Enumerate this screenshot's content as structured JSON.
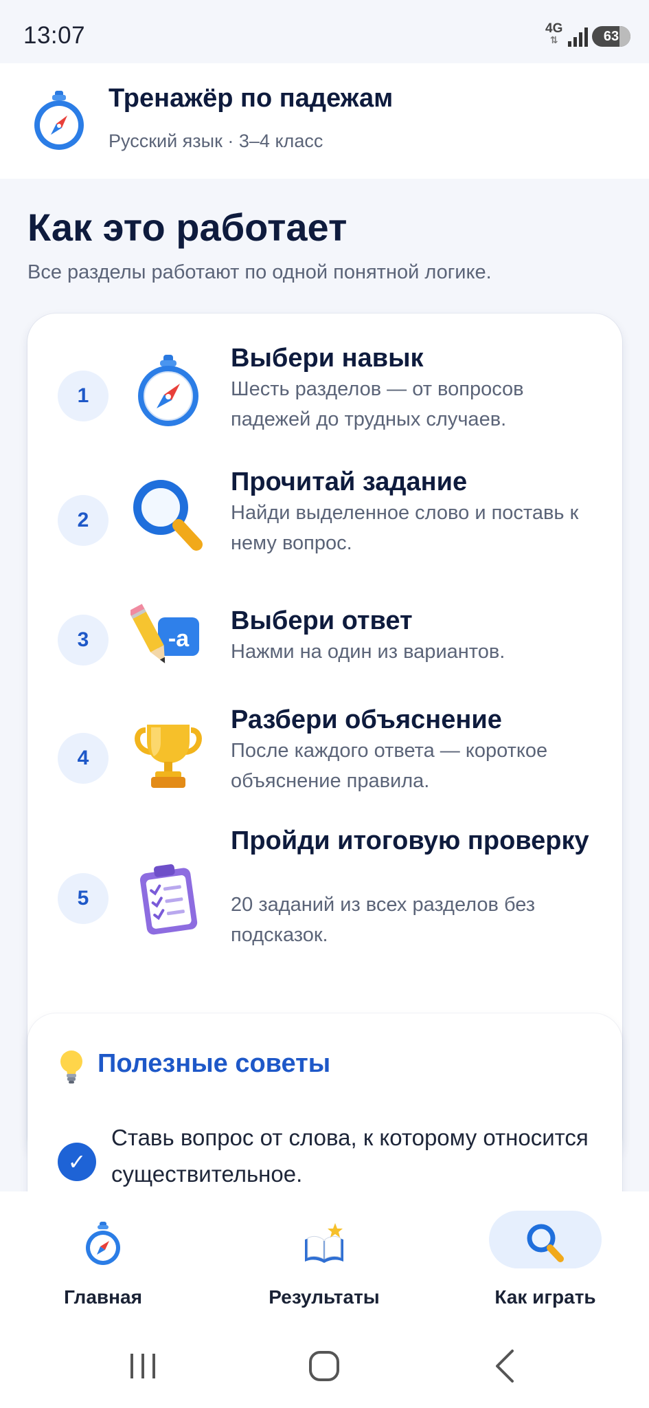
{
  "status_bar": {
    "time": "13:07",
    "network": "4G",
    "battery": "63"
  },
  "app_bar": {
    "title": "Тренажёр по падежам",
    "subtitle": "Русский язык · 3–4 класс",
    "logo_icon": "compass-icon"
  },
  "page": {
    "title": "Как это работает",
    "subtitle": "Все разделы работают по одной понятной логике."
  },
  "steps": [
    {
      "number": "1",
      "icon": "compass-icon",
      "title": "Выбери навык",
      "description": "Шесть разделов — от вопросов падежей до трудных случаев."
    },
    {
      "number": "2",
      "icon": "magnifier-icon",
      "title": "Прочитай задание",
      "description": "Найди выделенное слово и поставь к нему вопрос."
    },
    {
      "number": "3",
      "icon": "pencil-letter-icon",
      "title": "Выбери ответ",
      "description": "Нажми на один из вариантов."
    },
    {
      "number": "4",
      "icon": "trophy-icon",
      "title": "Разбери объяснение",
      "description": "После каждого ответа — короткое объяснение правила."
    },
    {
      "number": "5",
      "icon": "clipboard-checklist-icon",
      "title": "Пройди итоговую проверку",
      "description": "20 заданий из всех разделов без подсказок."
    }
  ],
  "tips": {
    "title": "Полезные советы",
    "icon": "lightbulb-icon",
    "items": [
      {
        "text": "Ставь вопрос от слова, к которому относится существительное."
      }
    ]
  },
  "bottom_nav": {
    "items": [
      {
        "label": "Главная",
        "icon": "compass-icon",
        "active": false
      },
      {
        "label": "Результаты",
        "icon": "open-book-star-icon",
        "active": false
      },
      {
        "label": "Как играть",
        "icon": "magnifier-icon",
        "active": true
      }
    ]
  },
  "colors": {
    "accent": "#1e58c8",
    "background": "#f4f6fb",
    "card": "#ffffff",
    "text_primary": "#0e1b3d",
    "text_secondary": "#5b6478",
    "active_pill": "#e6effd"
  }
}
